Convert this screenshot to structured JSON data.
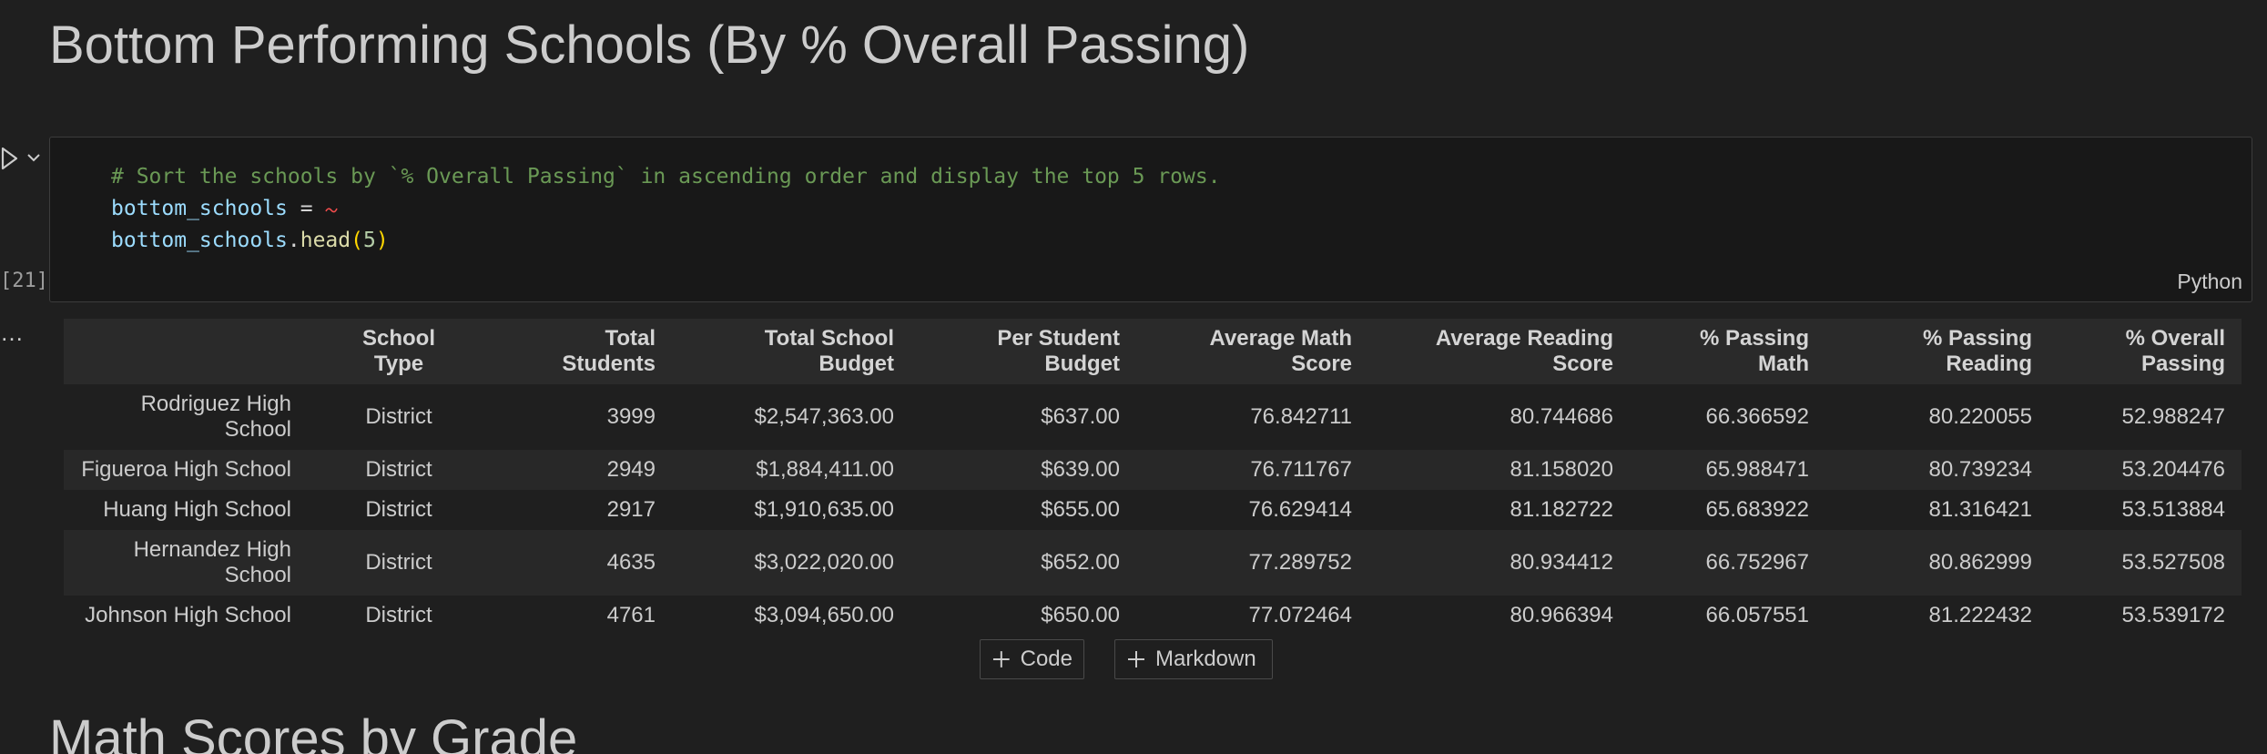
{
  "headings": {
    "top": "Bottom Performing Schools (By % Overall Passing)",
    "bottom": "Math Scores by Grade"
  },
  "cell": {
    "execution_count": "[21]",
    "more_label": "…",
    "language": "Python",
    "code": {
      "comment": "# Sort the schools by `% Overall Passing` in ascending order and display the top 5 rows.",
      "line2_var": "bottom_schools",
      "line2_op": " =",
      "line3_var": "bottom_schools",
      "line3_dot": ".",
      "line3_fn": "head",
      "line3_open": "(",
      "line3_arg": "5",
      "line3_close": ")"
    }
  },
  "table": {
    "columns": [
      "",
      "School Type",
      "Total Students",
      "Total School Budget",
      "Per Student Budget",
      "Average Math Score",
      "Average Reading Score",
      "% Passing Math",
      "% Passing Reading",
      "% Overall Passing"
    ],
    "rows": [
      [
        "Rodriguez High School",
        "District",
        "3999",
        "$2,547,363.00",
        "$637.00",
        "76.842711",
        "80.744686",
        "66.366592",
        "80.220055",
        "52.988247"
      ],
      [
        "Figueroa High School",
        "District",
        "2949",
        "$1,884,411.00",
        "$639.00",
        "76.711767",
        "81.158020",
        "65.988471",
        "80.739234",
        "53.204476"
      ],
      [
        "Huang High School",
        "District",
        "2917",
        "$1,910,635.00",
        "$655.00",
        "76.629414",
        "81.182722",
        "65.683922",
        "81.316421",
        "53.513884"
      ],
      [
        "Hernandez High School",
        "District",
        "4635",
        "$3,022,020.00",
        "$652.00",
        "77.289752",
        "80.934412",
        "66.752967",
        "80.862999",
        "53.527508"
      ],
      [
        "Johnson High School",
        "District",
        "4761",
        "$3,094,650.00",
        "$650.00",
        "77.072464",
        "80.966394",
        "66.057551",
        "81.222432",
        "53.539172"
      ]
    ]
  },
  "toolbar": {
    "add_code_label": "Code",
    "add_markdown_label": "Markdown"
  },
  "colors": {
    "background": "#1f1f1f",
    "comment": "#6a9955",
    "variable": "#9cdcfe",
    "function": "#dcdcaa"
  },
  "icons": [
    "run-icon",
    "chevron-down-icon",
    "plus-icon"
  ]
}
